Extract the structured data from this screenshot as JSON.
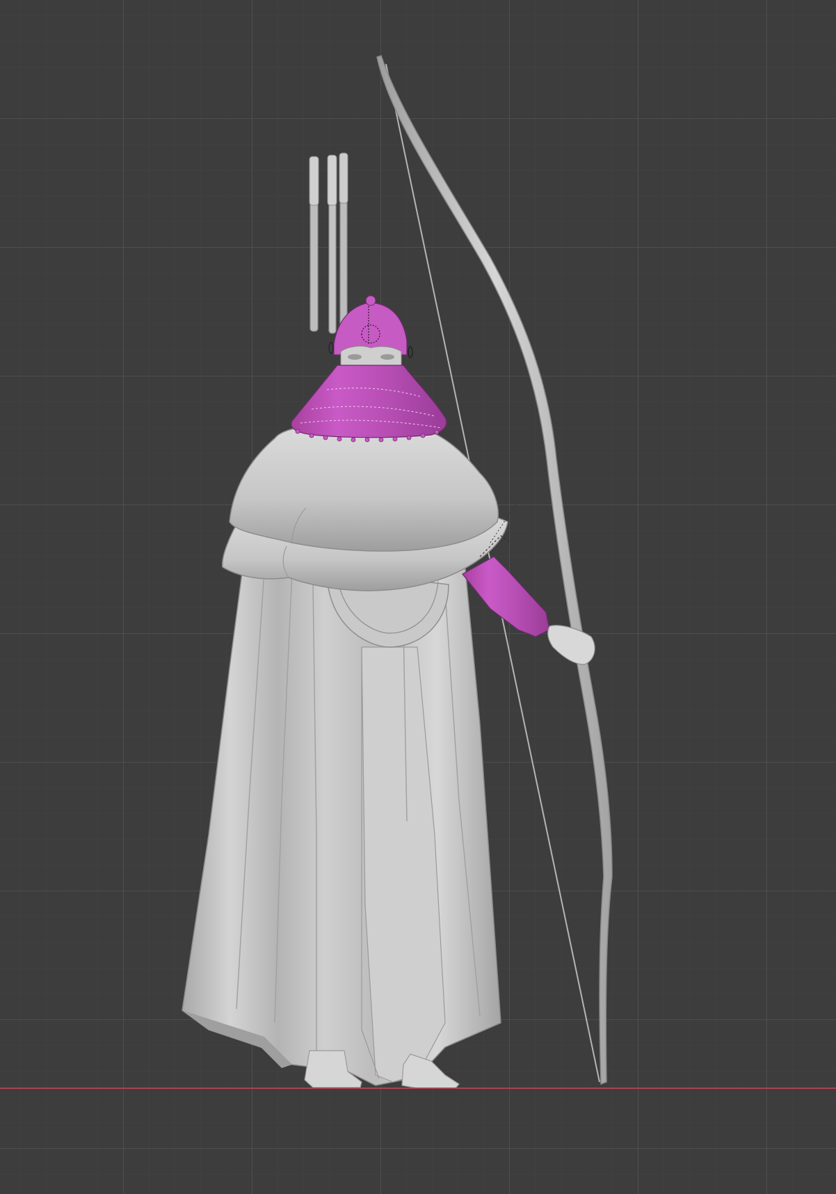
{
  "viewport": {
    "background_color": "#3d3d3d",
    "grid_major_color": "#5a5a5a",
    "grid_minor_color": "#464646",
    "x_axis_color": "#a84452"
  },
  "scene": {
    "cloth_color": "#c4c4c4",
    "cloth_shadow_color": "#9b9b9b",
    "cloth_highlight_color": "#dcdcdc",
    "selected_color": "#c256c0",
    "selected_dark_color": "#8f3a8e",
    "skin_color": "#d2d2d2",
    "bow_color": "#c9c9c9",
    "string_color": "#b0b0b0"
  }
}
